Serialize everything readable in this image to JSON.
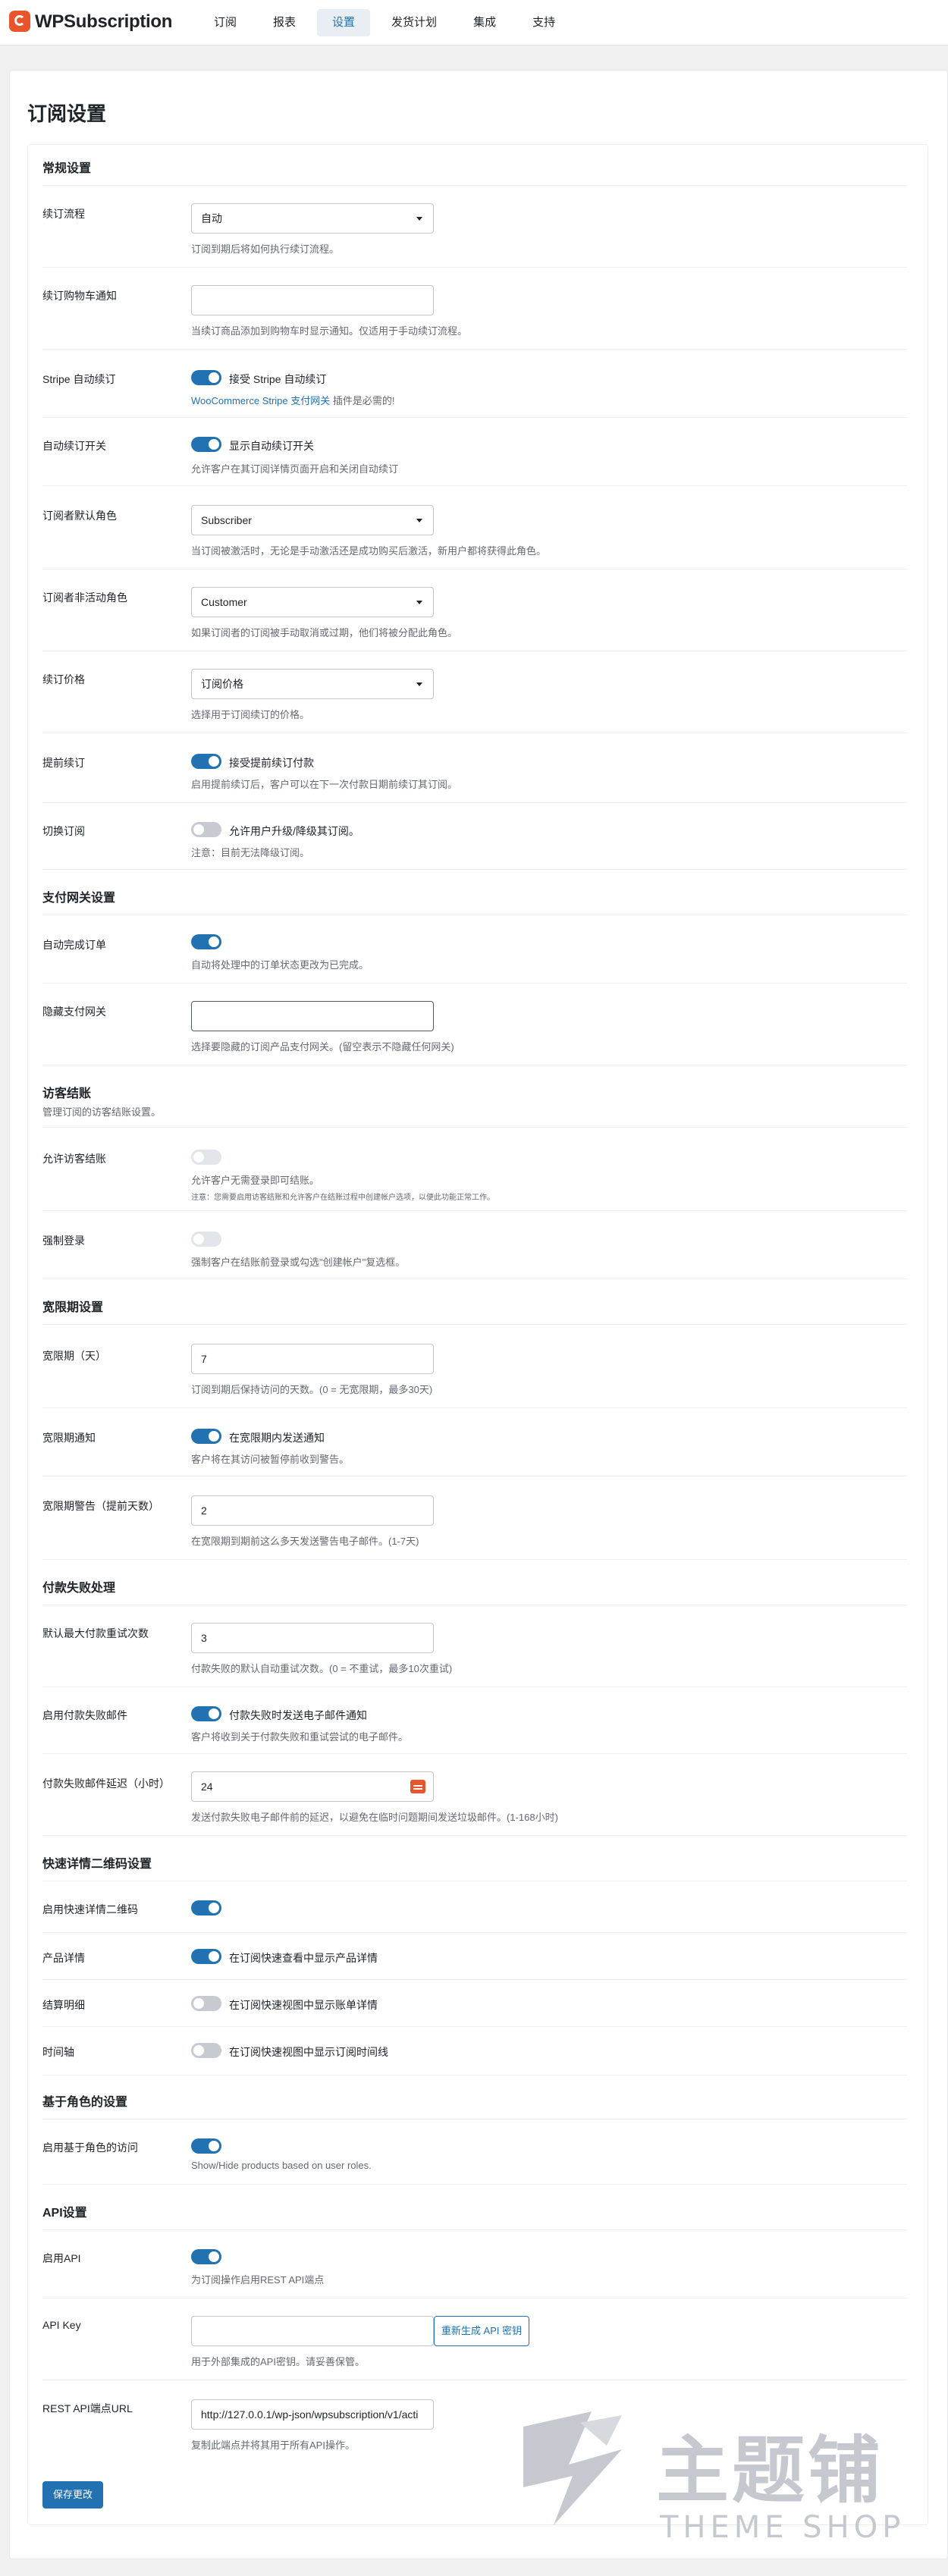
{
  "app": {
    "name": "WPSubscription"
  },
  "nav": {
    "tabs": [
      "订阅",
      "报表",
      "设置",
      "发货计划",
      "集成",
      "支持"
    ]
  },
  "page": {
    "title": "订阅设置"
  },
  "general": {
    "title": "常规设置",
    "renewal_flow": {
      "label": "续订流程",
      "value": "自动",
      "hint": "订阅到期后将如何执行续订流程。"
    },
    "renewal_cart_notice": {
      "label": "续订购物车通知",
      "value": "",
      "hint": "当续订商品添加到购物车时显示通知。仅适用于手动续订流程。"
    },
    "stripe_auto": {
      "label": "Stripe 自动续订",
      "toggle_label": "接受 Stripe 自动续订",
      "hint_link": "WooCommerce Stripe 支付网关",
      "hint_rest": " 插件是必需的!"
    },
    "auto_renew_toggle": {
      "label": "自动续订开关",
      "toggle_label": "显示自动续订开关",
      "hint": "允许客户在其订阅详情页面开启和关闭自动续订"
    },
    "default_role": {
      "label": "订阅者默认角色",
      "value": "Subscriber",
      "hint": "当订阅被激活时，无论是手动激活还是成功购买后激活，新用户都将获得此角色。"
    },
    "inactive_role": {
      "label": "订阅者非活动角色",
      "value": "Customer",
      "hint": "如果订阅者的订阅被手动取消或过期，他们将被分配此角色。"
    },
    "renewal_price": {
      "label": "续订价格",
      "value": "订阅价格",
      "hint": "选择用于订阅续订的价格。"
    },
    "early_renewal": {
      "label": "提前续订",
      "toggle_label": "接受提前续订付款",
      "hint": "启用提前续订后，客户可以在下一次付款日期前续订其订阅。"
    },
    "switch": {
      "label": "切换订阅",
      "toggle_label": "允许用户升级/降级其订阅。",
      "hint": "注意：目前无法降级订阅。"
    }
  },
  "gateway": {
    "title": "支付网关设置",
    "auto_complete": {
      "label": "自动完成订单",
      "hint": "自动将处理中的订单状态更改为已完成。"
    },
    "hide_gateways": {
      "label": "隐藏支付网关",
      "value": "",
      "hint": "选择要隐藏的订阅产品支付网关。(留空表示不隐藏任何网关)"
    }
  },
  "guest": {
    "title": "访客结账",
    "subtitle": "管理订阅的访客结账设置。",
    "allow": {
      "label": "允许访客结账",
      "hint": "允许客户无需登录即可结账。",
      "note": "注意：您需要启用访客结账和允许客户在结账过程中创建帐户选项，以便此功能正常工作。"
    },
    "force_login": {
      "label": "强制登录",
      "hint": "强制客户在结账前登录或勾选\"创建帐户\"复选框。"
    }
  },
  "grace": {
    "title": "宽限期设置",
    "days": {
      "label": "宽限期（天）",
      "value": "7",
      "hint": "订阅到期后保持访问的天数。(0 = 无宽限期，最多30天)"
    },
    "notice": {
      "label": "宽限期通知",
      "toggle_label": "在宽限期内发送通知",
      "hint": "客户将在其访问被暂停前收到警告。"
    },
    "warning": {
      "label": "宽限期警告（提前天数）",
      "value": "2",
      "hint": "在宽限期到期前这么多天发送警告电子邮件。(1-7天)"
    }
  },
  "failure": {
    "title": "付款失败处理",
    "max_retries": {
      "label": "默认最大付款重试次数",
      "value": "3",
      "hint": "付款失败的默认自动重试次数。(0 = 不重试，最多10次重试)"
    },
    "email": {
      "label": "启用付款失败邮件",
      "toggle_label": "付款失败时发送电子邮件通知",
      "hint": "客户将收到关于付款失败和重试尝试的电子邮件。"
    },
    "delay": {
      "label": "付款失败邮件延迟（小时）",
      "value": "24",
      "hint": "发送付款失败电子邮件前的延迟，以避免在临时问题期间发送垃圾邮件。(1-168小时)"
    }
  },
  "qr": {
    "title": "快速详情二维码设置",
    "enable": {
      "label": "启用快速详情二维码"
    },
    "product": {
      "label": "产品详情",
      "toggle_label": "在订阅快速查看中显示产品详情"
    },
    "billing": {
      "label": "结算明细",
      "toggle_label": "在订阅快速视图中显示账单详情"
    },
    "timeline": {
      "label": "时间轴",
      "toggle_label": "在订阅快速视图中显示订阅时间线"
    }
  },
  "role": {
    "title": "基于角色的设置",
    "enable": {
      "label": "启用基于角色的访问",
      "hint": "Show/Hide products based on user roles."
    }
  },
  "api": {
    "title": "API设置",
    "enable": {
      "label": "启用API",
      "hint": "为订阅操作启用REST API端点"
    },
    "key": {
      "label": "API Key",
      "value": "",
      "button": "重新生成 API 密钥",
      "hint": "用于外部集成的API密钥。请妥善保管。"
    },
    "url": {
      "label": "REST API端点URL",
      "value": "http://127.0.0.1/wp-json/wpsubscription/v1/acti",
      "hint": "复制此端点并将其用于所有API操作。"
    }
  },
  "save_label": "保存更改",
  "watermark": {
    "cn": "主题铺",
    "en": "THEME SHOP"
  },
  "colors": {
    "accent": "#2271b1",
    "brand": "#e8542b"
  }
}
